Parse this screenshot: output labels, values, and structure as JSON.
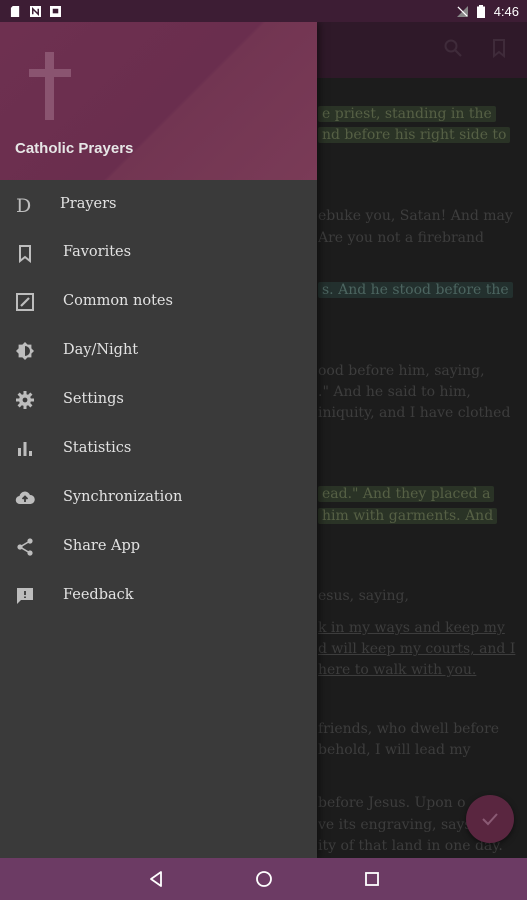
{
  "status_bar": {
    "left_icons": [
      "sd-card-icon",
      "n-icon",
      "square-notification-icon"
    ],
    "time": "4:46"
  },
  "app_bar": {
    "actions": [
      "search-icon",
      "bookmark-icon"
    ]
  },
  "drawer": {
    "title": "Catholic Prayers",
    "items": [
      {
        "label": "Prayers",
        "icon": "d-letter-icon"
      },
      {
        "label": "Favorites",
        "icon": "bookmark-icon"
      },
      {
        "label": "Common notes",
        "icon": "edit-note-icon"
      },
      {
        "label": "Day/Night",
        "icon": "brightness-icon"
      },
      {
        "label": "Settings",
        "icon": "gear-icon"
      },
      {
        "label": "Statistics",
        "icon": "bar-chart-icon"
      },
      {
        "label": "Synchronization",
        "icon": "cloud-upload-icon"
      },
      {
        "label": "Share App",
        "icon": "share-icon"
      },
      {
        "label": "Feedback",
        "icon": "feedback-icon"
      }
    ]
  },
  "background_text": {
    "lines": [
      "e priest, standing in the",
      "nd before his right side to",
      "ebuke you, Satan! And may",
      "Are you not a firebrand",
      "s. And he stood before the",
      "ood before him, saying,",
      ".\" And he said to him,",
      "iniquity, and I have clothed",
      "ead.\" And they placed a",
      "him with garments. And",
      "esus, saying,",
      "k in my ways and keep my",
      "d will keep my courts, and I",
      "here to walk with you.",
      "friends, who dwell before",
      "behold, I will lead my",
      "before Jesus. Upon o",
      "ve its engraving, says",
      "ity of that land in one day."
    ]
  },
  "fab": {
    "icon": "check-icon"
  },
  "nav_bar": {
    "buttons": [
      "back-icon",
      "home-icon",
      "recents-icon"
    ]
  },
  "colors": {
    "status_bar": "#3d1d34",
    "drawer_header": "#6e3050",
    "drawer_bg": "#3a3a3a",
    "nav_bar": "#6c3b64",
    "fab": "#5a2640",
    "text_highlight_green": "#2a3326",
    "text_highlight_teal": "#23302e"
  }
}
